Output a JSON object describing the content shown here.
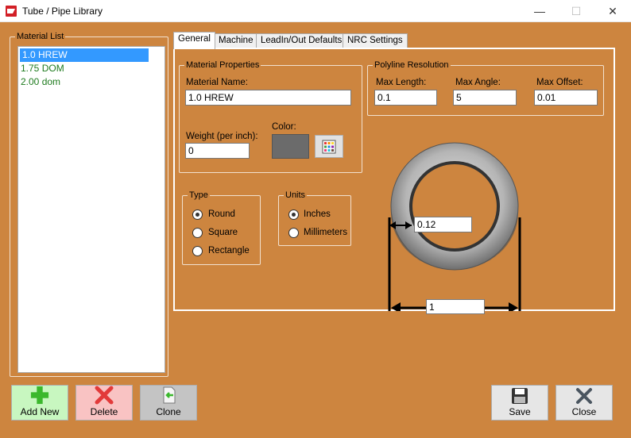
{
  "window": {
    "title": "Tube / Pipe Library",
    "minimize": "—",
    "maximize": "☐",
    "close": "✕"
  },
  "material_list": {
    "legend": "Material List",
    "items": [
      {
        "label": "1.0 HREW",
        "selected": true
      },
      {
        "label": "1.75 DOM",
        "selected": false
      },
      {
        "label": "2.00 dom",
        "selected": false
      }
    ]
  },
  "tabs": [
    {
      "label": "General",
      "active": true
    },
    {
      "label": "Machine",
      "active": false
    },
    {
      "label": "LeadIn/Out Defaults",
      "active": false
    },
    {
      "label": "NRC Settings",
      "active": false
    }
  ],
  "material_properties": {
    "legend": "Material Properties",
    "name_label": "Material Name:",
    "name_value": "1.0 HREW",
    "weight_label": "Weight (per inch):",
    "weight_value": "0",
    "color_label": "Color:",
    "color_value": "#6b6b6b"
  },
  "polyline_resolution": {
    "legend": "Polyline Resolution",
    "max_length_label": "Max Length:",
    "max_length_value": "0.1",
    "max_angle_label": "Max Angle:",
    "max_angle_value": "5",
    "max_offset_label": "Max Offset:",
    "max_offset_value": "0.01"
  },
  "type_group": {
    "legend": "Type",
    "options": [
      {
        "label": "Round",
        "checked": true
      },
      {
        "label": "Square",
        "checked": false
      },
      {
        "label": "Rectangle",
        "checked": false
      }
    ]
  },
  "units_group": {
    "legend": "Units",
    "options": [
      {
        "label": "Inches",
        "checked": true
      },
      {
        "label": "Millimeters",
        "checked": false
      }
    ]
  },
  "diagram": {
    "wall_thickness": "0.12",
    "outer_diameter": "1"
  },
  "buttons": {
    "add_new": "Add New",
    "delete": "Delete",
    "clone": "Clone",
    "save": "Save",
    "close": "Close"
  },
  "colors": {
    "background": "#cd853f",
    "selection": "#3399ff",
    "list_text": "#1e7b1e"
  }
}
